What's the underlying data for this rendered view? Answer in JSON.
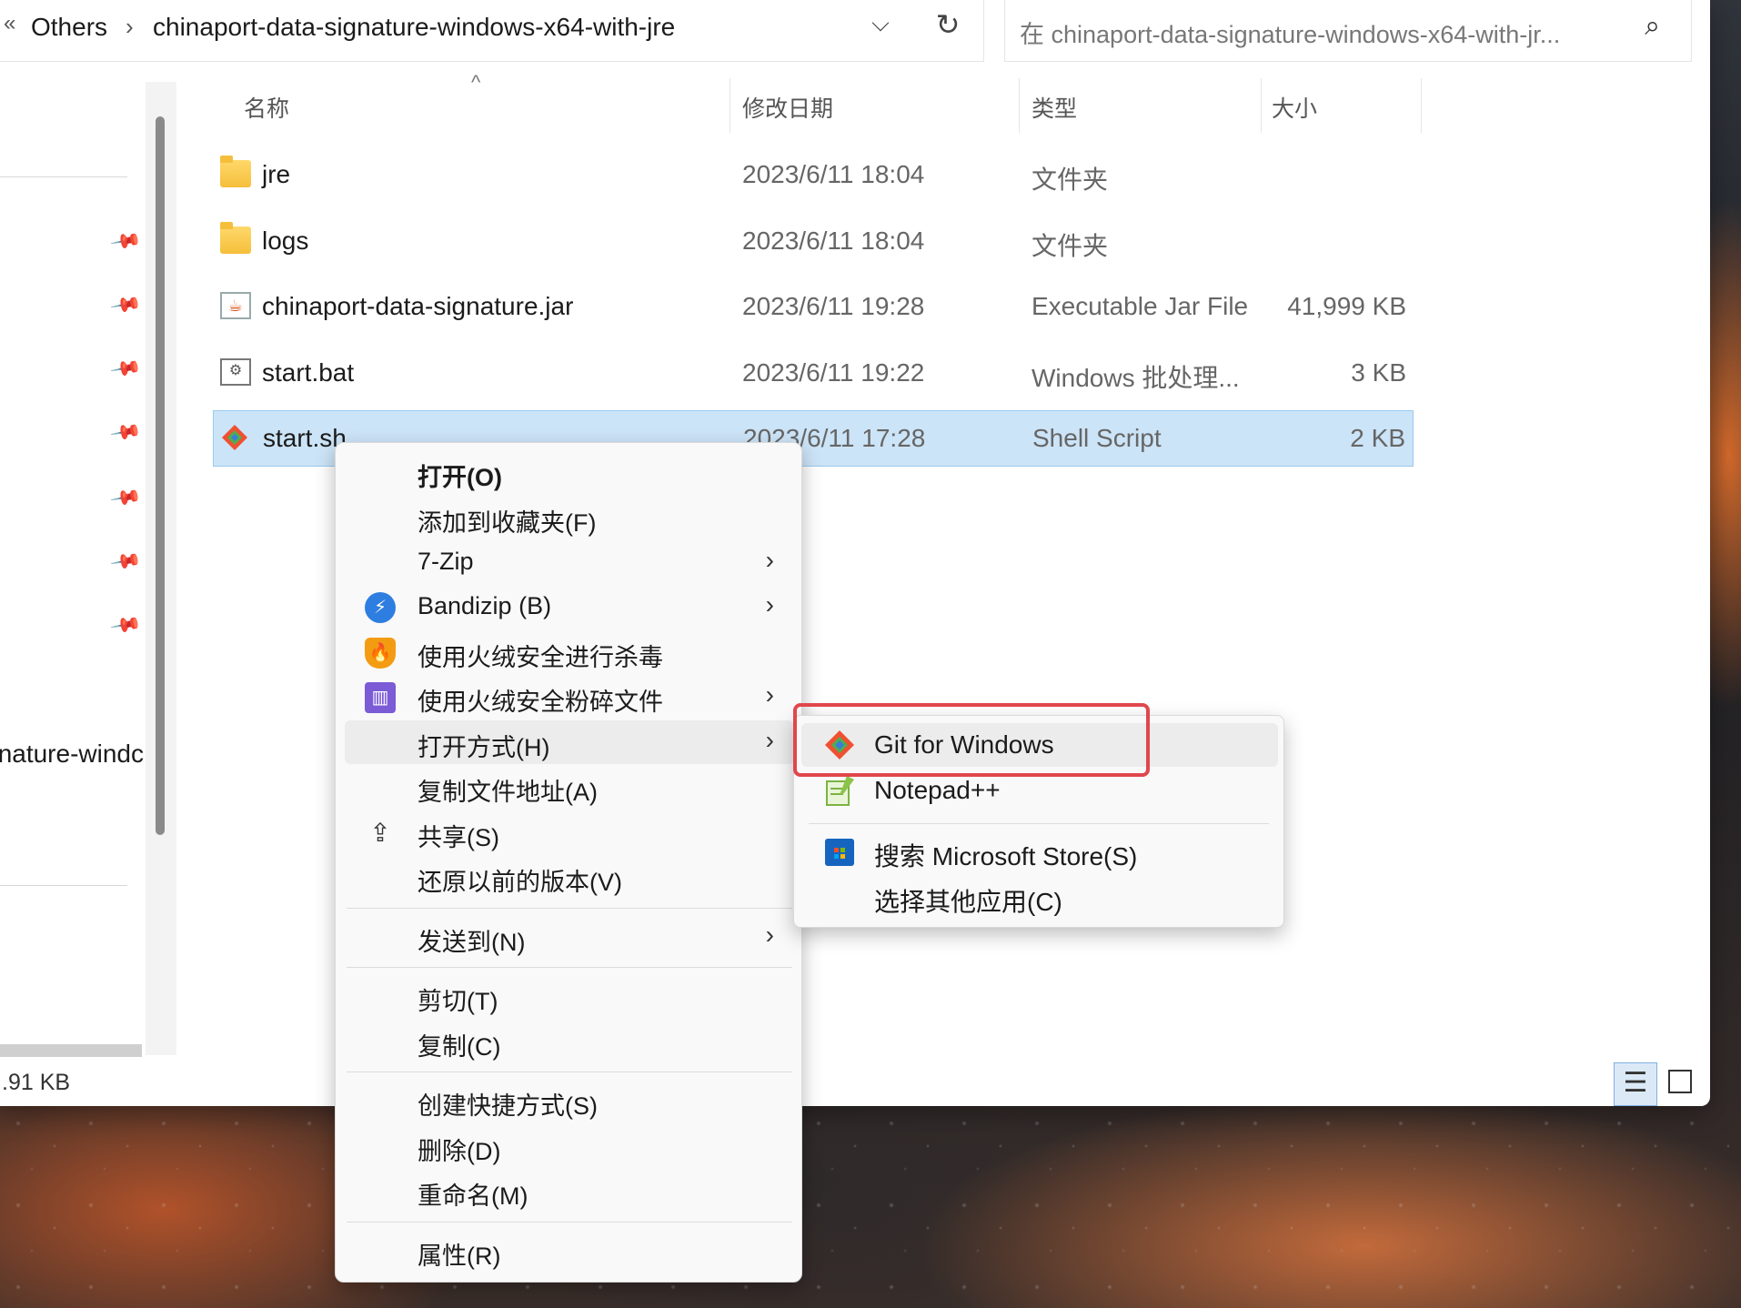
{
  "address_bar": {
    "overflow_glyph": "«",
    "crumbs": [
      "Others",
      "chinaport-data-signature-windows-x64-with-jre"
    ],
    "separator": "›",
    "dropdown_glyph": "⌵",
    "refresh_glyph": "↻"
  },
  "search": {
    "placeholder": "在 chinaport-data-signature-windows-x64-with-jr...",
    "icon_glyph": "⌕"
  },
  "nav_pane": {
    "visible_item": "nature-windc",
    "pin_glyph": "📌"
  },
  "columns": {
    "name": "名称",
    "modified": "修改日期",
    "type": "类型",
    "size": "大小",
    "sort_glyph": "^"
  },
  "files": [
    {
      "name": "jre",
      "modified": "2023/6/11 18:04",
      "type": "文件夹",
      "size": "",
      "icon": "folder-icon"
    },
    {
      "name": "logs",
      "modified": "2023/6/11 18:04",
      "type": "文件夹",
      "size": "",
      "icon": "folder-icon"
    },
    {
      "name": "chinaport-data-signature.jar",
      "modified": "2023/6/11 19:28",
      "type": "Executable Jar File",
      "size": "41,999 KB",
      "icon": "jar-icon"
    },
    {
      "name": "start.bat",
      "modified": "2023/6/11 19:22",
      "type": "Windows 批处理...",
      "size": "3 KB",
      "icon": "bat-icon"
    },
    {
      "name": "start.sh",
      "modified": "2023/6/11 17:28",
      "type": "Shell Script",
      "size": "2 KB",
      "icon": "git-icon",
      "selected": true
    }
  ],
  "status_bar": {
    "selection_size": ".91 KB",
    "details_glyph": "☰"
  },
  "context_menu": {
    "items": [
      {
        "label": "打开(O)"
      },
      {
        "label": "添加到收藏夹(F)"
      },
      {
        "label": "7-Zip",
        "chevron": "›"
      },
      {
        "label": "Bandizip (B)",
        "chevron": "›",
        "icon": "bandizip-icon"
      },
      {
        "label": "使用火绒安全进行杀毒",
        "icon": "huorong-shield-icon"
      },
      {
        "label": "使用火绒安全粉碎文件",
        "chevron": "›",
        "icon": "shredder-icon"
      },
      {
        "label": "打开方式(H)",
        "chevron": "›"
      },
      {
        "label": "复制文件地址(A)"
      },
      {
        "label": "共享(S)",
        "icon": "share-icon",
        "icon_glyph": "⇪"
      },
      {
        "label": "还原以前的版本(V)"
      },
      {
        "label": "发送到(N)",
        "chevron": "›"
      },
      {
        "label": "剪切(T)"
      },
      {
        "label": "复制(C)"
      },
      {
        "label": "创建快捷方式(S)"
      },
      {
        "label": "删除(D)"
      },
      {
        "label": "重命名(M)"
      },
      {
        "label": "属性(R)"
      }
    ]
  },
  "open_with_submenu": {
    "items": [
      {
        "label": "Git for Windows",
        "icon": "git-icon",
        "highlighted": true
      },
      {
        "label": "Notepad++",
        "icon": "notepadpp-icon"
      },
      {
        "label": "搜索 Microsoft Store(S)",
        "icon": "microsoft-store-icon"
      },
      {
        "label": "选择其他应用(C)"
      }
    ]
  },
  "colors": {
    "selection_bg": "#cce4f7",
    "highlight_border": "#e0474c",
    "git_orange": "#f05032"
  }
}
